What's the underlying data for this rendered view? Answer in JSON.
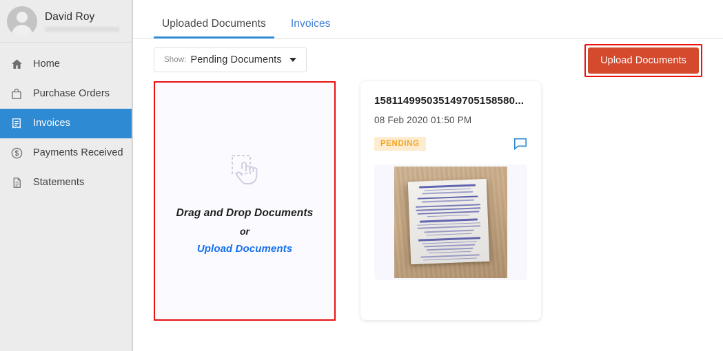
{
  "sidebar": {
    "profile": {
      "name": "David Roy",
      "subtitle_redacted": true,
      "avatar_icon": "user-avatar-icon"
    },
    "items": [
      {
        "label": "Home",
        "icon": "home-icon",
        "active": false
      },
      {
        "label": "Purchase Orders",
        "icon": "shopping-bag-icon",
        "active": false
      },
      {
        "label": "Invoices",
        "icon": "receipt-icon",
        "active": true
      },
      {
        "label": "Payments Received",
        "icon": "dollar-circle-icon",
        "active": false
      },
      {
        "label": "Statements",
        "icon": "document-icon",
        "active": false
      }
    ]
  },
  "main": {
    "tabs": [
      {
        "label": "Uploaded Documents",
        "active": true
      },
      {
        "label": "Invoices",
        "active": false
      }
    ],
    "toolbar": {
      "show_label": "Show:",
      "show_value": "Pending Documents",
      "caret_icon": "chevron-down-icon",
      "upload_button_label": "Upload Documents"
    },
    "dropzone": {
      "icon": "drag-drop-hand-icon",
      "title": "Drag and Drop Documents",
      "or": "or",
      "link": "Upload Documents"
    },
    "documents": [
      {
        "title": "158114995035149705158580...",
        "date": "08 Feb 2020 01:50 PM",
        "status": "PENDING",
        "chat_icon": "chat-bubble-icon",
        "thumbnail": "receipt-photo"
      }
    ]
  },
  "colors": {
    "accent_blue": "#2f8ad4",
    "link_blue": "#1570ef",
    "upload_orange": "#d5492d",
    "highlight_red": "#ee1111",
    "badge_text": "#f5a623",
    "badge_bg": "#fdeccf",
    "sidebar_bg": "#ececec",
    "dropzone_bg": "#fafaff"
  }
}
